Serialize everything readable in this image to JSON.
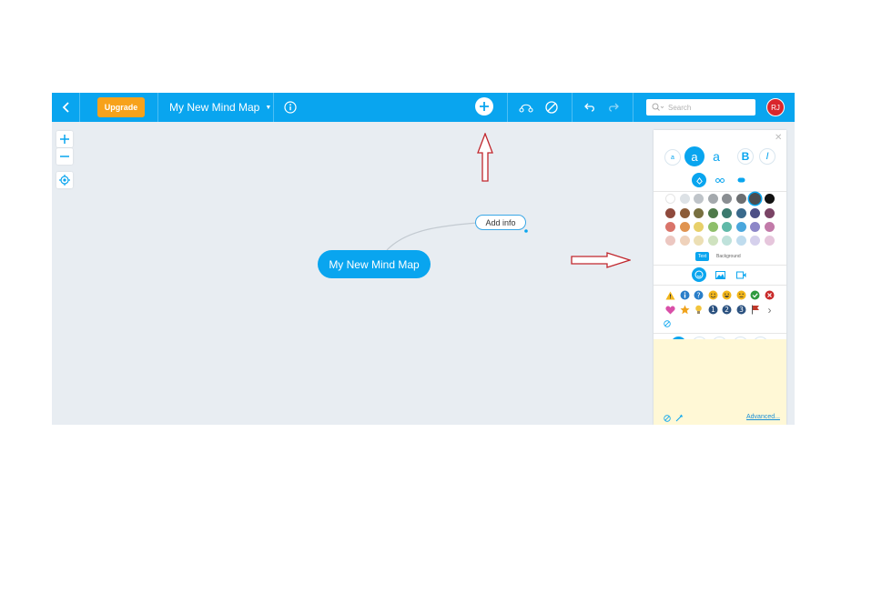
{
  "toolbar": {
    "upgrade_label": "Upgrade",
    "map_title": "My New Mind Map",
    "search_placeholder": "Search",
    "avatar_initials": "RJ"
  },
  "canvas": {
    "root_node": "My New Mind Map",
    "info_node": "Add info"
  },
  "panel": {
    "fill_toggle_text": "Text",
    "fill_toggle_background": "Background",
    "advanced_link": "Advanced...",
    "bold_label": "B",
    "italic_label": "I",
    "font_small_label": "a",
    "font_medium_label": "a",
    "font_large_label": "a"
  },
  "colors": {
    "accent": "#09a5ef",
    "upgrade": "#f7a21b",
    "avatar": "#d9262c",
    "canvas": "#e8edf2",
    "notes_bg": "#fff8d6",
    "annotation_arrow": "#c1272d"
  }
}
